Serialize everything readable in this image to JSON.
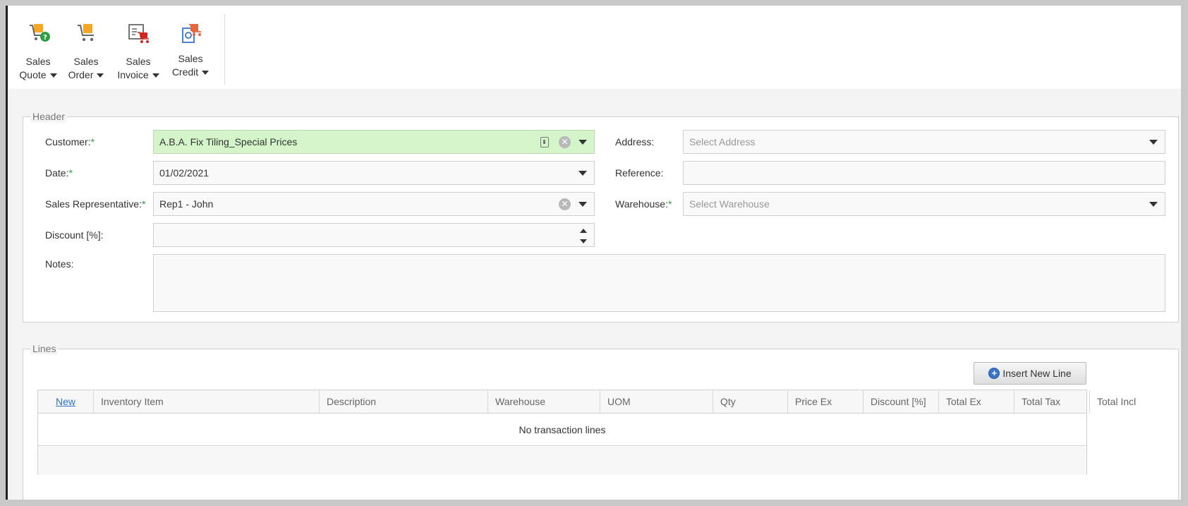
{
  "ribbon": {
    "buttons": [
      {
        "line1": "Sales",
        "line2": "Quote"
      },
      {
        "line1": "Sales",
        "line2": "Order"
      },
      {
        "line1": "Sales",
        "line2": "Invoice"
      },
      {
        "line1": "Sales",
        "line2": "Credit"
      }
    ]
  },
  "header": {
    "legend": "Header",
    "customer": {
      "label": "Customer:",
      "value": "A.B.A. Fix Tiling_Special Prices"
    },
    "date": {
      "label": "Date:",
      "value": "01/02/2021"
    },
    "rep": {
      "label": "Sales Representative:",
      "value": "Rep1 - John"
    },
    "discount": {
      "label": "Discount [%]:",
      "value": ""
    },
    "notes": {
      "label": "Notes:",
      "value": ""
    },
    "address": {
      "label": "Address:",
      "placeholder": "Select Address"
    },
    "reference": {
      "label": "Reference:",
      "value": ""
    },
    "warehouse": {
      "label": "Warehouse:",
      "placeholder": "Select Warehouse"
    },
    "required_mark": "*"
  },
  "lines": {
    "legend": "Lines",
    "insert_label": "Insert New Line",
    "insert_icon_glyph": "+",
    "columns": [
      "New",
      "Inventory Item",
      "Description",
      "Warehouse",
      "UOM",
      "Qty",
      "Price Ex",
      "Discount [%]",
      "Total Ex",
      "Total Tax",
      "Total Incl"
    ],
    "empty_text": "No transaction lines"
  },
  "colors": {
    "required": "#2e9e3e",
    "customer_bg": "#d4f5ca",
    "link": "#2a72c4"
  }
}
